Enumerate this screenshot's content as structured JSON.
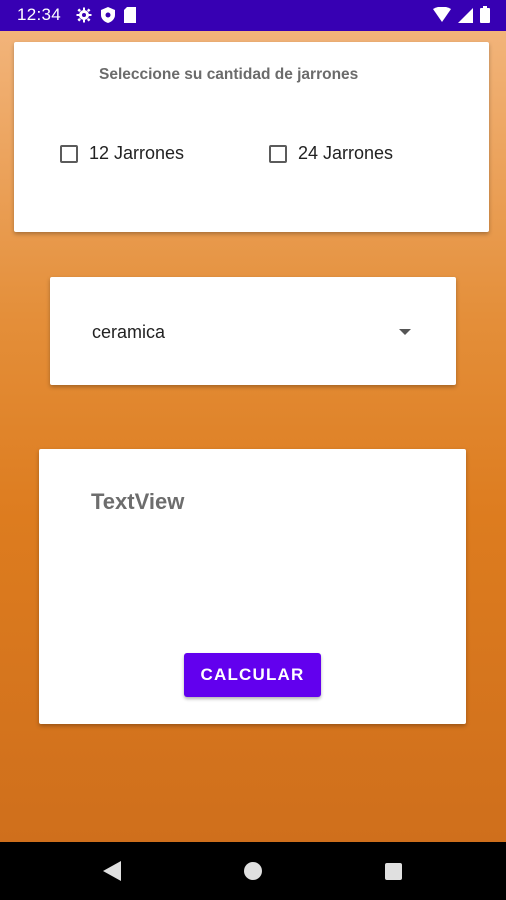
{
  "status_bar": {
    "time": "12:34",
    "left_icons": [
      "gear-icon",
      "shield-icon",
      "sd-card-icon"
    ],
    "right_icons": [
      "wifi-icon",
      "signal-icon",
      "battery-icon"
    ],
    "background": "#3700b3"
  },
  "quantity_card": {
    "prompt": "Seleccione su cantidad de jarrones",
    "options": [
      {
        "label": "12 Jarrones",
        "checked": false
      },
      {
        "label": "24 Jarrones",
        "checked": false
      }
    ]
  },
  "material_spinner": {
    "selected": "ceramica"
  },
  "result_card": {
    "text": "TextView",
    "button_label": "CALCULAR",
    "button_color": "#6200ee"
  },
  "nav_bar": {
    "buttons": [
      "back-icon",
      "home-icon",
      "recents-icon"
    ]
  }
}
